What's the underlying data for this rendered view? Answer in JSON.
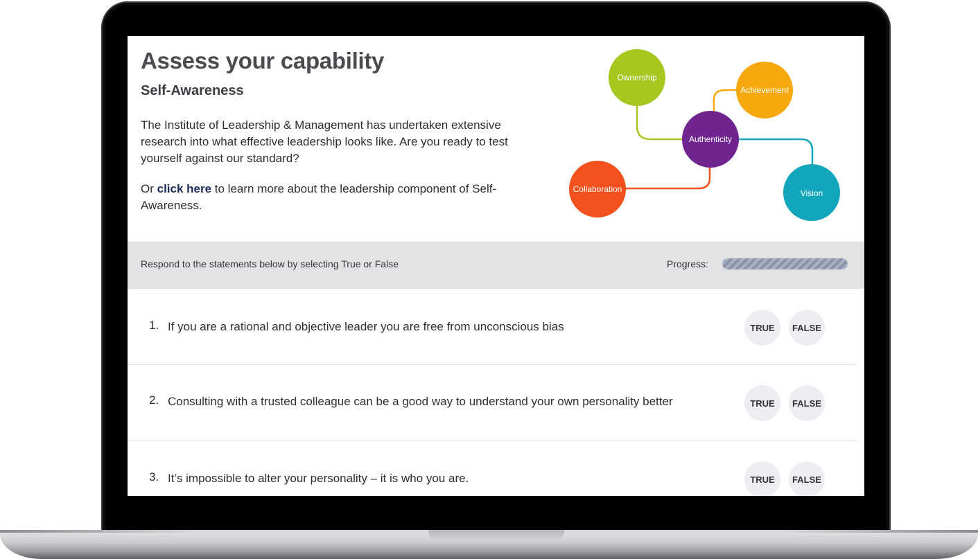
{
  "page": {
    "title": "Assess your capability",
    "section": "Self-Awareness",
    "intro": "The Institute of Leadership & Management has undertaken extensive research into what effective leadership looks like. Are you ready to test yourself against our standard?",
    "learn_prefix": "Or ",
    "learn_link": "click here",
    "learn_suffix": " to learn more about the leadership component of Self-Awareness."
  },
  "diagram": {
    "nodes": [
      {
        "label": "Ownership",
        "color": "#a6c71e"
      },
      {
        "label": "Achievement",
        "color": "#f7a80d"
      },
      {
        "label": "Authenticity",
        "color": "#6f2490"
      },
      {
        "label": "Collaboration",
        "color": "#f4511e"
      },
      {
        "label": "Vision",
        "color": "#12a6bd"
      }
    ]
  },
  "instructions": {
    "text": "Respond to the statements below by selecting True or False",
    "progress_label": "Progress:",
    "progress_fraction": 1.0
  },
  "questions": [
    {
      "number": "1.",
      "text": "If you are a rational and objective leader you are free from unconscious bias",
      "true_label": "TRUE",
      "false_label": "FALSE"
    },
    {
      "number": "2.",
      "text": "Consulting with a trusted colleague can be a good way to understand your own personality better",
      "true_label": "TRUE",
      "false_label": "FALSE"
    },
    {
      "number": "3.",
      "text": "It’s impossible to alter your personality – it is who you are.",
      "true_label": "TRUE",
      "false_label": "FALSE"
    }
  ]
}
